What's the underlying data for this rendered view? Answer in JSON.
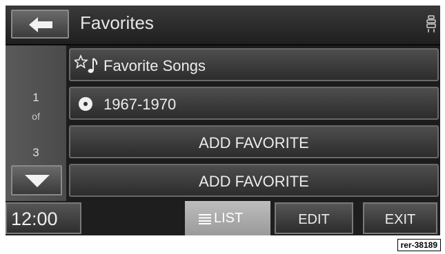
{
  "header": {
    "title": "Favorites",
    "back_icon": "left-arrow-icon",
    "nav_icon": "vehicle-seat-icon"
  },
  "pager": {
    "current": "1",
    "of_label": "of",
    "total": "3",
    "down_icon": "down-triangle-icon"
  },
  "rows": [
    {
      "label": "Favorite Songs",
      "icon": "star-music-note-icon"
    },
    {
      "label": "1967-1970",
      "icon": "disc-icon"
    },
    {
      "label": "ADD FAVORITE"
    },
    {
      "label": "ADD FAVORITE"
    }
  ],
  "bottom_bar": {
    "clock": "12:00",
    "list_label": "LIST",
    "list_icon": "list-icon",
    "edit_label": "EDIT",
    "exit_label": "EXIT"
  },
  "ref_code": "rer-38189"
}
